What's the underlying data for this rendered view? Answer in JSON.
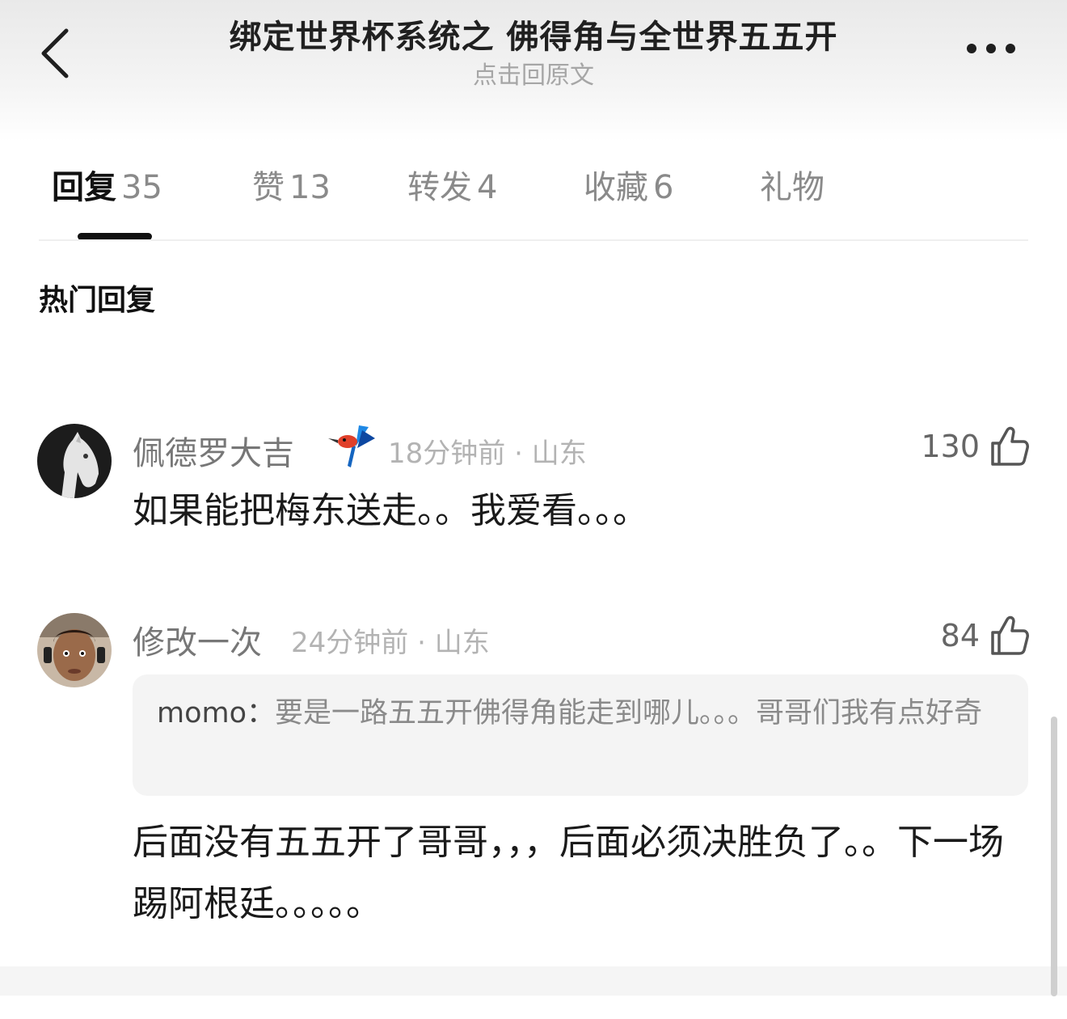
{
  "header": {
    "title": "绑定世界杯系统之 佛得角与全世界五五开",
    "subtitle": "点击回原文"
  },
  "tabs": [
    {
      "label": "回复",
      "count": "35"
    },
    {
      "label": "赞",
      "count": "13"
    },
    {
      "label": "转发",
      "count": "4"
    },
    {
      "label": "收藏",
      "count": "6"
    },
    {
      "label": "礼物",
      "count": ""
    }
  ],
  "section_title": "热门回复",
  "comments": [
    {
      "username": "佩德罗大吉",
      "badge_icon": "hummingbird-badge-icon",
      "time": "18分钟前",
      "location": "山东",
      "likes": "130",
      "content": "如果能把梅东送走。。我爱看。。。"
    },
    {
      "username": "修改一次",
      "time": "24分钟前",
      "location": "山东",
      "likes": "84",
      "quote_user": "momo：",
      "quote_text": "要是一路五五开佛得角能走到哪儿。。。哥哥们我有点好奇",
      "content": "后面没有五五开了哥哥，，，后面必须决胜负了。。下一场踢阿根廷。。。。。"
    }
  ],
  "colors": {
    "text_primary": "#1a1a1a",
    "text_secondary": "#777777",
    "text_muted": "#b3b3b3",
    "quote_bg": "#f4f4f4"
  }
}
